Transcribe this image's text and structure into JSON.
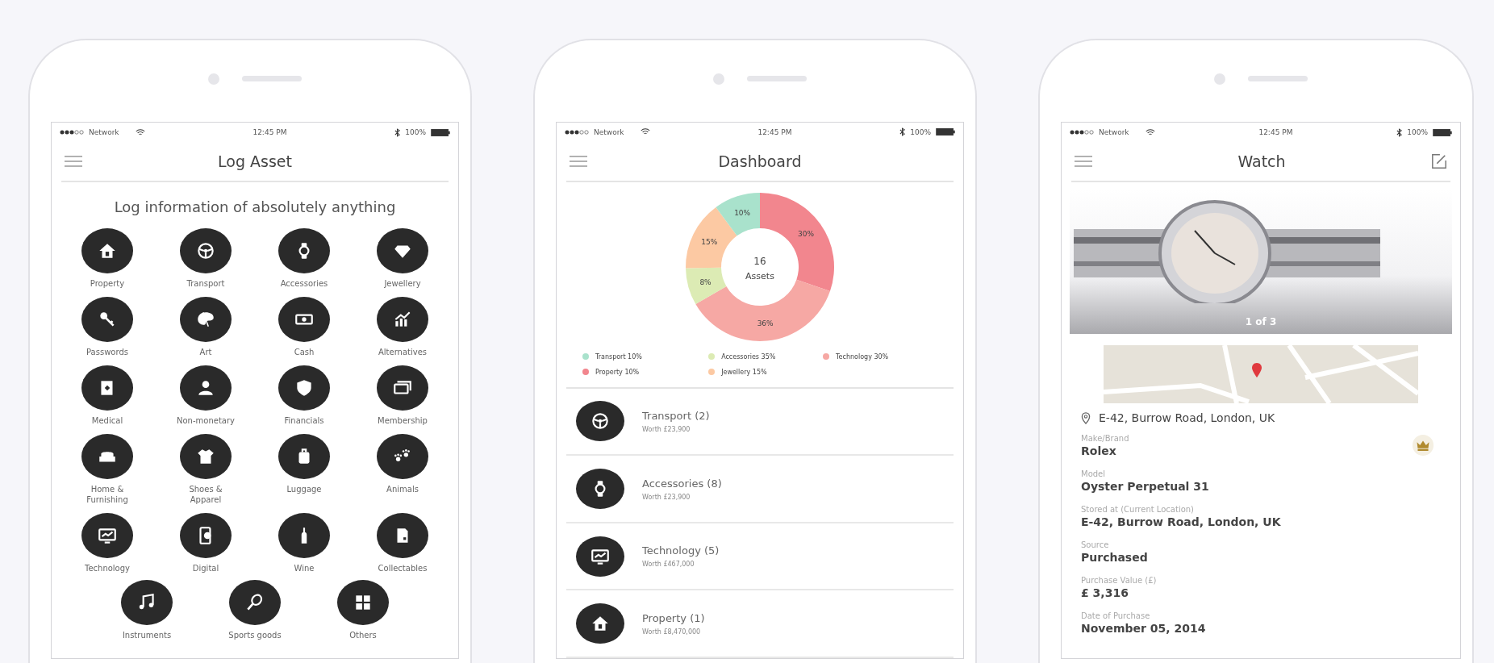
{
  "log_asset_screen": {
    "status_bar": {
      "carrier": "Network",
      "time": "12:45 PM",
      "battery": "100%"
    },
    "title": "Log Asset",
    "subtitle": "Log information of absolutely anything",
    "categories": [
      {
        "label": "Property"
      },
      {
        "label": "Transport"
      },
      {
        "label": "Accessories"
      },
      {
        "label": "Jewellery"
      },
      {
        "label": "Passwords"
      },
      {
        "label": "Art"
      },
      {
        "label": "Cash"
      },
      {
        "label": "Alternatives"
      },
      {
        "label": "Medical"
      },
      {
        "label": "Non-monetary"
      },
      {
        "label": "Financials"
      },
      {
        "label": "Membership"
      },
      {
        "label": "Home &\nFurnishing"
      },
      {
        "label": "Shoes &\nApparel"
      },
      {
        "label": "Luggage"
      },
      {
        "label": "Animals"
      },
      {
        "label": "Technology"
      },
      {
        "label": "Digital"
      },
      {
        "label": "Wine"
      },
      {
        "label": "Collectables"
      }
    ],
    "bottom_row": [
      {
        "label": "Instruments"
      },
      {
        "label": "Sports goods"
      },
      {
        "label": "Others"
      }
    ]
  },
  "dashboard_screen": {
    "status_bar": {
      "carrier": "Network",
      "time": "12:45 PM",
      "battery": "100%"
    },
    "title": "Dashboard",
    "chart": {
      "center_value": "16",
      "center_label": "Assets",
      "chart_data": {
        "type": "donut",
        "colors": [
          "#f2868e",
          "#f6a8a4",
          "#dcebb4",
          "#fcc9a3",
          "#a9e2cc"
        ],
        "series": [
          {
            "values": [
              30,
              36,
              8,
              15,
              10
            ]
          }
        ],
        "value_labels": [
          "30%",
          "36%",
          "8%",
          "15%",
          "10%"
        ]
      }
    },
    "legend": [
      {
        "label": "Transport 10%",
        "color": "#a9e2cc"
      },
      {
        "label": "Accessories 35%",
        "color": "#dcebb4"
      },
      {
        "label": "Technology 30%",
        "color": "#f6a8a4"
      },
      {
        "label": "Property 10%",
        "color": "#f2868e"
      },
      {
        "label": "Jewellery 15%",
        "color": "#fcc9a3"
      }
    ],
    "asset_groups": [
      {
        "title": "Transport (2)",
        "worth": "Worth £23,900"
      },
      {
        "title": "Accessories (8)",
        "worth": "Worth £23,900"
      },
      {
        "title": "Technology (5)",
        "worth": "Worth £467,000"
      },
      {
        "title": "Property (1)",
        "worth": "Worth £8,470,000"
      }
    ]
  },
  "watch_screen": {
    "status_bar": {
      "carrier": "Network",
      "time": "12:45 PM",
      "battery": "100%"
    },
    "title": "Watch",
    "photo_counter": "1 of 3",
    "address": "E-42, Burrow Road, London, UK",
    "fields": [
      {
        "label": "Make/Brand",
        "value": "Rolex"
      },
      {
        "label": "Model",
        "value": "Oyster Perpetual 31"
      },
      {
        "label": "Stored at (Current Location)",
        "value": "E-42, Burrow Road, London, UK"
      },
      {
        "label": "Source",
        "value": "Purchased"
      },
      {
        "label": "Purchase Value (£)",
        "value": "£ 3,316"
      },
      {
        "label": "Date of Purchase",
        "value": "November 05, 2014"
      }
    ]
  }
}
